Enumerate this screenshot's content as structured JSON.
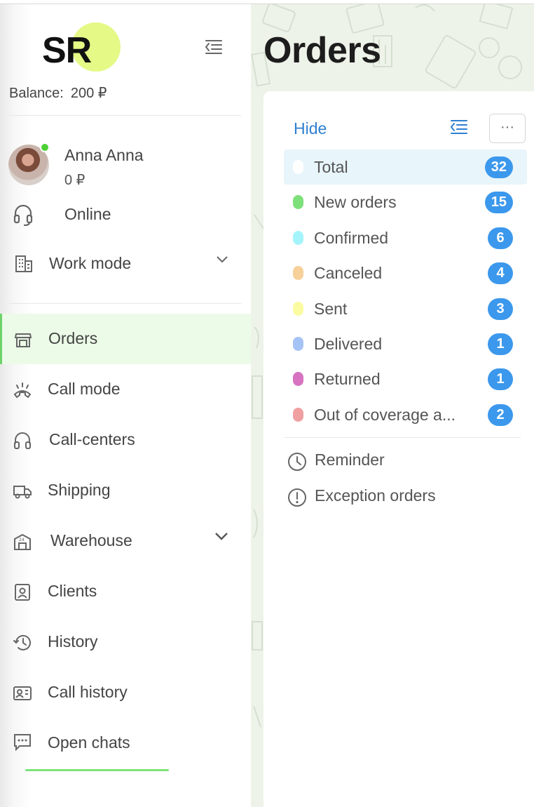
{
  "brand": {
    "logo_text": "SR"
  },
  "balance": {
    "label": "Balance:",
    "value": "200 ₽"
  },
  "user": {
    "name": "Anna Anna",
    "balance": "0 ₽"
  },
  "online": {
    "label": "Online"
  },
  "work_mode": {
    "label": "Work mode"
  },
  "nav": {
    "items": [
      {
        "label": "Orders",
        "icon": "store-icon"
      },
      {
        "label": "Call mode",
        "icon": "phone-ring-icon"
      },
      {
        "label": "Call-centers",
        "icon": "headphones-icon"
      },
      {
        "label": "Shipping",
        "icon": "truck-icon"
      },
      {
        "label": "Warehouse",
        "icon": "warehouse-icon"
      },
      {
        "label": "Clients",
        "icon": "contact-card-icon"
      },
      {
        "label": "History",
        "icon": "history-icon"
      },
      {
        "label": "Call history",
        "icon": "call-history-icon"
      },
      {
        "label": "Open chats",
        "icon": "chat-icon"
      }
    ]
  },
  "page": {
    "title": "Orders"
  },
  "panel": {
    "hide_label": "Hide",
    "more_label": "···",
    "statuses": [
      {
        "label": "Total",
        "count": "32",
        "color": "#ffffff"
      },
      {
        "label": "New orders",
        "count": "15",
        "color": "#7ee07a"
      },
      {
        "label": "Confirmed",
        "count": "6",
        "color": "#a6f4fb"
      },
      {
        "label": "Canceled",
        "count": "4",
        "color": "#f7d09a"
      },
      {
        "label": "Sent",
        "count": "3",
        "color": "#fbfba1"
      },
      {
        "label": "Delivered",
        "count": "1",
        "color": "#a6c3f5"
      },
      {
        "label": "Returned",
        "count": "1",
        "color": "#d773c0"
      },
      {
        "label": "Out of coverage a...",
        "count": "2",
        "color": "#f0a0a0"
      }
    ],
    "extras": [
      {
        "label": "Reminder",
        "icon": "clock-icon"
      },
      {
        "label": "Exception orders",
        "icon": "exclamation-circle-icon"
      }
    ]
  },
  "colors": {
    "accent": "#3b98ec",
    "active_nav_bg": "#ecfbe8",
    "logo_circle": "#e4f986",
    "online": "#4cd137"
  }
}
